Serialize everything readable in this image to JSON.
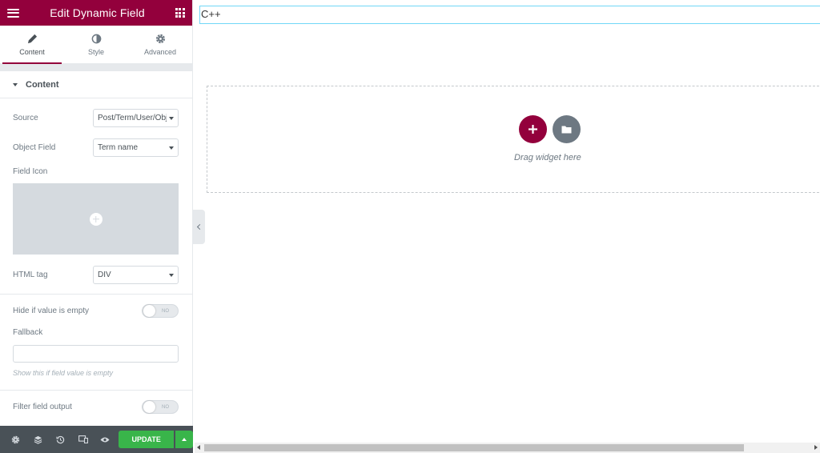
{
  "header": {
    "title": "Edit Dynamic Field",
    "menu_icon": "hamburger-icon",
    "apps_icon": "grid-icon"
  },
  "tabs": [
    {
      "label": "Content",
      "icon": "pencil-icon",
      "active": true
    },
    {
      "label": "Style",
      "icon": "half-circle-icon",
      "active": false
    },
    {
      "label": "Advanced",
      "icon": "gear-icon",
      "active": false
    }
  ],
  "section": {
    "title": "Content"
  },
  "fields": {
    "source": {
      "label": "Source",
      "value": "Post/Term/User/Object"
    },
    "object_field": {
      "label": "Object Field",
      "value": "Term name"
    },
    "field_icon": {
      "label": "Field Icon"
    },
    "html_tag": {
      "label": "HTML tag",
      "value": "DIV"
    },
    "hide_if_empty": {
      "label": "Hide if value is empty",
      "state": "NO"
    },
    "fallback": {
      "label": "Fallback",
      "value": "",
      "hint": "Show this if field value is empty"
    },
    "filter_output": {
      "label": "Filter field output",
      "state": "NO"
    }
  },
  "footer": {
    "update_label": "UPDATE"
  },
  "preview": {
    "text_widget": "C++",
    "drop_hint": "Drag widget here"
  },
  "colors": {
    "brand": "#93003c",
    "update": "#39b54a",
    "footer_bg": "#495157"
  }
}
